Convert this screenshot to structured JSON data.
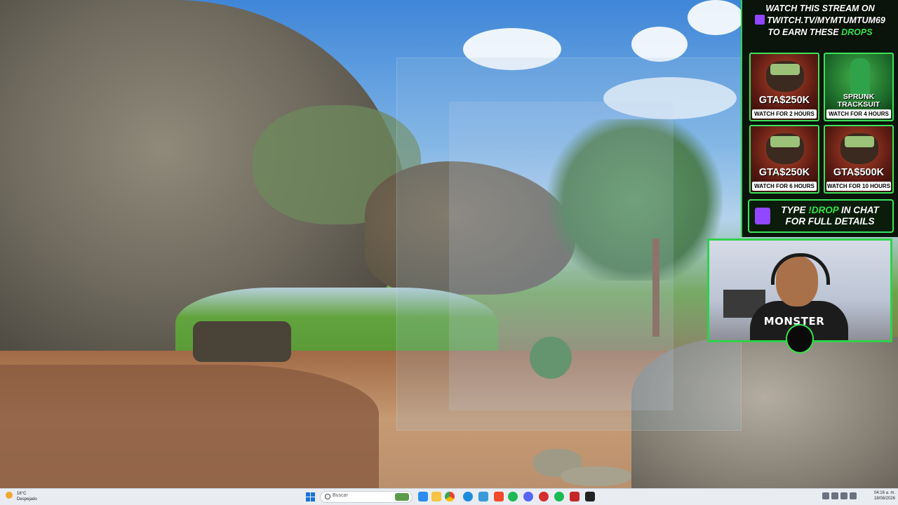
{
  "overlay": {
    "header": {
      "line1": "WATCH THIS STREAM ON",
      "url": "TWITCH.TV/MYMTUMTUM69",
      "line3_prefix": "TO EARN THESE",
      "line3_highlight": "DROPS"
    },
    "tiles": [
      {
        "amount": "GTA$250K",
        "when": "WATCH FOR 2 HOURS"
      },
      {
        "amount": "SPRUNK TRACKSUIT",
        "when": "WATCH FOR 4 HOURS"
      },
      {
        "amount": "GTA$250K",
        "when": "WATCH FOR 6 HOURS"
      },
      {
        "amount": "GTA$500K",
        "when": "WATCH FOR 10 HOURS"
      }
    ],
    "footer": {
      "prefix": "TYPE",
      "command": "!DROP",
      "suffix": "IN CHAT",
      "line2": "FOR FULL DETAILS"
    },
    "colors": {
      "accent": "#33e44a",
      "twitch": "#9146ff"
    }
  },
  "webcam": {
    "shirt_text": "MONSTER"
  },
  "taskbar": {
    "weather_temp": "16°C",
    "weather_desc": "Despejado",
    "search_placeholder": "Buscar",
    "time": "04:16 a. m.",
    "date": "18/08/2026"
  },
  "icons": [
    "windows-start-icon",
    "search-icon",
    "file-explorer-icon",
    "chrome-icon",
    "brave-icon",
    "edge-icon",
    "discord-icon",
    "spotify-icon",
    "obs-icon",
    "wifi-icon",
    "volume-icon",
    "battery-icon"
  ]
}
